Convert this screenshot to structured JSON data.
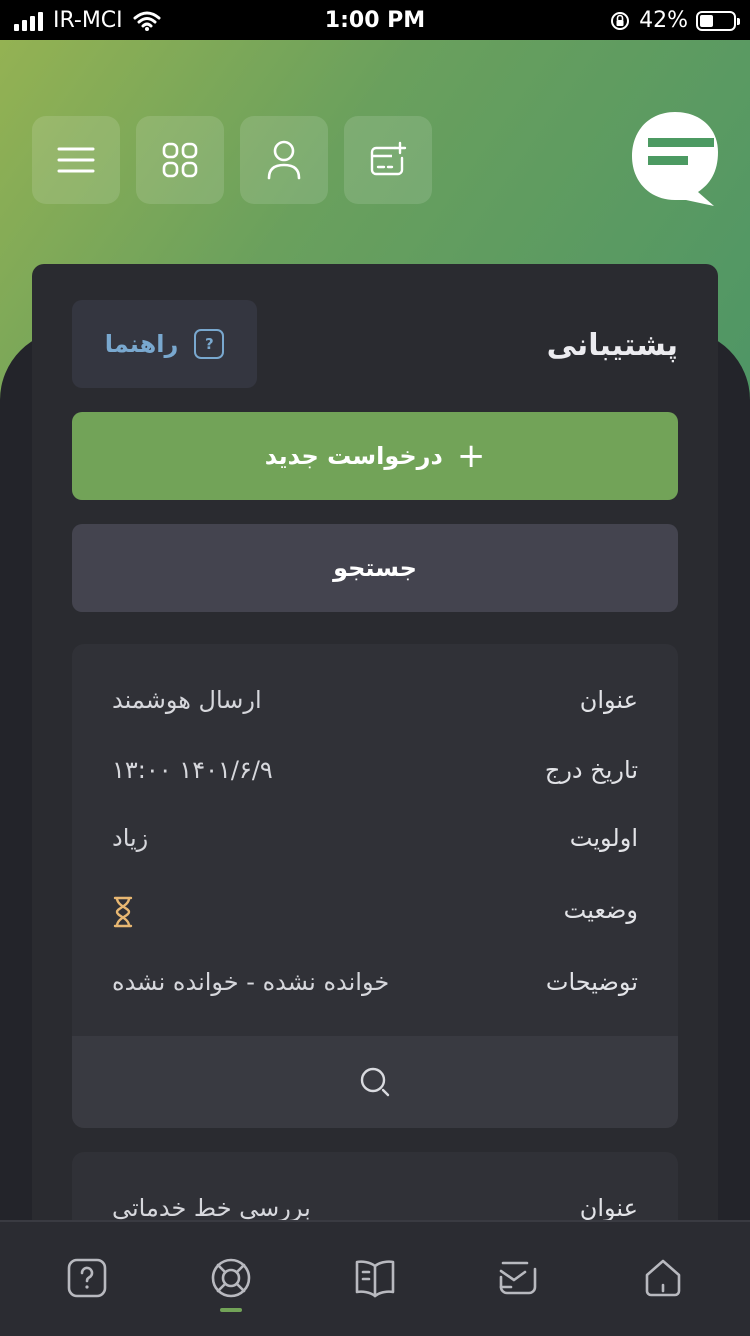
{
  "status_bar": {
    "carrier": "IR-MCI",
    "time": "1:00 PM",
    "battery_percent": "42%",
    "battery_level": 0.42
  },
  "header": {
    "icons": [
      "menu-icon",
      "apps-grid-icon",
      "profile-icon",
      "card-add-icon"
    ]
  },
  "page": {
    "title": "پشتیبانی",
    "guide_label": "راهنما",
    "new_request_label": "درخواست جدید",
    "search_label": "جستجو"
  },
  "tickets": [
    {
      "rows": [
        {
          "label": "عنوان",
          "value": "ارسال هوشمند"
        },
        {
          "label": "تاریخ درج",
          "value": "۱۴۰۱/۶/۹ ۱۳:۰۰"
        },
        {
          "label": "اولویت",
          "value": "زیاد"
        },
        {
          "label": "وضعیت",
          "value": "hourglass-icon"
        },
        {
          "label": "توضیحات",
          "value": "خوانده نشده - خوانده نشده"
        }
      ]
    },
    {
      "rows": [
        {
          "label": "عنوان",
          "value": "بررسی خط خدماتی"
        }
      ]
    }
  ],
  "bottom_nav": {
    "items": [
      "help-icon",
      "support-lifebuoy-icon",
      "book-icon",
      "inbox-icon",
      "home-icon"
    ],
    "active_index": 1,
    "accent_color": "#72a358"
  },
  "colors": {
    "brand_green": "#72a358",
    "background": "#23242a",
    "card": "#2a2b30",
    "guide_blue": "#79a8cf",
    "status_pending": "#e7b772"
  }
}
